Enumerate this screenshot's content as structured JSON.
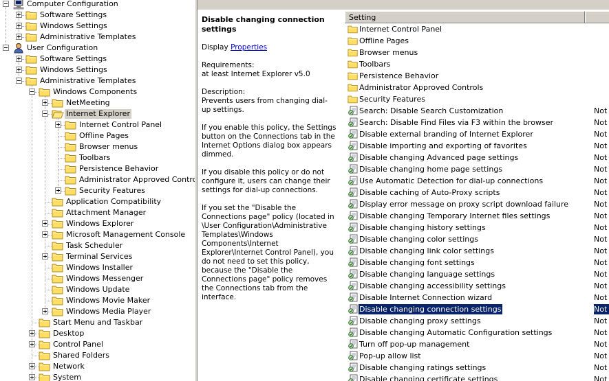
{
  "tree": [
    {
      "label": "Computer Configuration",
      "icon": "computer-icon",
      "toggle": "minus"
    },
    {
      "label": "Software Settings",
      "icon": "folder-icon",
      "toggle": "plus"
    },
    {
      "label": "Windows Settings",
      "icon": "folder-icon",
      "toggle": "plus"
    },
    {
      "label": "Administrative Templates",
      "icon": "folder-icon",
      "toggle": "plus"
    },
    {
      "label": "User Configuration",
      "icon": "user-icon",
      "toggle": "minus"
    },
    {
      "label": "Software Settings",
      "icon": "folder-icon",
      "toggle": "plus"
    },
    {
      "label": "Windows Settings",
      "icon": "folder-icon",
      "toggle": "plus"
    },
    {
      "label": "Administrative Templates",
      "icon": "folder-icon",
      "toggle": "minus"
    },
    {
      "label": "Windows Components",
      "icon": "folder-icon",
      "toggle": "minus"
    },
    {
      "label": "NetMeeting",
      "icon": "folder-icon",
      "toggle": "plus"
    },
    {
      "label": "Internet Explorer",
      "icon": "folder-open-icon",
      "toggle": "minus",
      "selected": true
    },
    {
      "label": "Internet Control Panel",
      "icon": "folder-icon",
      "toggle": "plus"
    },
    {
      "label": "Offline Pages",
      "icon": "folder-icon",
      "toggle": ""
    },
    {
      "label": "Browser menus",
      "icon": "folder-icon",
      "toggle": ""
    },
    {
      "label": "Toolbars",
      "icon": "folder-icon",
      "toggle": ""
    },
    {
      "label": "Persistence Behavior",
      "icon": "folder-icon",
      "toggle": ""
    },
    {
      "label": "Administrator Approved Controls",
      "icon": "folder-icon",
      "toggle": ""
    },
    {
      "label": "Security Features",
      "icon": "folder-icon",
      "toggle": "plus"
    },
    {
      "label": "Application Compatibility",
      "icon": "folder-icon",
      "toggle": ""
    },
    {
      "label": "Attachment Manager",
      "icon": "folder-icon",
      "toggle": ""
    },
    {
      "label": "Windows Explorer",
      "icon": "folder-icon",
      "toggle": "plus"
    },
    {
      "label": "Microsoft Management Console",
      "icon": "folder-icon",
      "toggle": "plus"
    },
    {
      "label": "Task Scheduler",
      "icon": "folder-icon",
      "toggle": ""
    },
    {
      "label": "Terminal Services",
      "icon": "folder-icon",
      "toggle": "plus"
    },
    {
      "label": "Windows Installer",
      "icon": "folder-icon",
      "toggle": ""
    },
    {
      "label": "Windows Messenger",
      "icon": "folder-icon",
      "toggle": ""
    },
    {
      "label": "Windows Update",
      "icon": "folder-icon",
      "toggle": ""
    },
    {
      "label": "Windows Movie Maker",
      "icon": "folder-icon",
      "toggle": ""
    },
    {
      "label": "Windows Media Player",
      "icon": "folder-icon",
      "toggle": "plus"
    },
    {
      "label": "Start Menu and Taskbar",
      "icon": "folder-icon",
      "toggle": ""
    },
    {
      "label": "Desktop",
      "icon": "folder-icon",
      "toggle": "plus"
    },
    {
      "label": "Control Panel",
      "icon": "folder-icon",
      "toggle": "plus"
    },
    {
      "label": "Shared Folders",
      "icon": "folder-icon",
      "toggle": ""
    },
    {
      "label": "Network",
      "icon": "folder-icon",
      "toggle": "plus"
    },
    {
      "label": "System",
      "icon": "folder-icon",
      "toggle": "plus"
    }
  ],
  "description": {
    "title": "Disable changing connection settings",
    "display_label": "Display",
    "display_link": "Properties",
    "requirements_label": "Requirements:",
    "requirements_value": "at least Internet Explorer v5.0",
    "description_label": "Description:",
    "description_value": "Prevents users from changing dial-up settings.",
    "para_enable": "If you enable this policy, the Settings button on the Connections tab in the Internet Options dialog box appears dimmed.",
    "para_disable": "If you disable this policy or do not configure it, users can change their settings for dial-up connections.",
    "para_note": "If you set the \"Disable the Connections page\" policy (located in \\User Configuration\\Administrative Templates\\Windows Components\\Internet Explorer\\Internet Control Panel), you do not need to set this policy, because the \"Disable the Connections page\" policy removes the Connections tab from the interface."
  },
  "list": {
    "header_setting": "Setting",
    "rows": [
      {
        "name": "Internet Control Panel",
        "type": "folder",
        "state": ""
      },
      {
        "name": "Offline Pages",
        "type": "folder",
        "state": ""
      },
      {
        "name": "Browser menus",
        "type": "folder",
        "state": ""
      },
      {
        "name": "Toolbars",
        "type": "folder",
        "state": ""
      },
      {
        "name": "Persistence Behavior",
        "type": "folder",
        "state": ""
      },
      {
        "name": "Administrator Approved Controls",
        "type": "folder",
        "state": ""
      },
      {
        "name": "Security Features",
        "type": "folder",
        "state": ""
      },
      {
        "name": "Search: Disable Search Customization",
        "type": "policy",
        "state": "Not"
      },
      {
        "name": "Search: Disable Find Files via F3 within the browser",
        "type": "policy",
        "state": "Not"
      },
      {
        "name": "Disable external branding of Internet Explorer",
        "type": "policy",
        "state": "Not"
      },
      {
        "name": "Disable importing and exporting of favorites",
        "type": "policy",
        "state": "Not"
      },
      {
        "name": "Disable changing Advanced page settings",
        "type": "policy",
        "state": "Not"
      },
      {
        "name": "Disable changing home page settings",
        "type": "policy",
        "state": "Not"
      },
      {
        "name": "Use Automatic Detection for dial-up connections",
        "type": "policy",
        "state": "Not"
      },
      {
        "name": "Disable caching of Auto-Proxy scripts",
        "type": "policy",
        "state": "Not"
      },
      {
        "name": "Display error message on proxy script download failure",
        "type": "policy",
        "state": "Not"
      },
      {
        "name": "Disable changing Temporary Internet files settings",
        "type": "policy",
        "state": "Not"
      },
      {
        "name": "Disable changing history settings",
        "type": "policy",
        "state": "Not"
      },
      {
        "name": "Disable changing color settings",
        "type": "policy",
        "state": "Not"
      },
      {
        "name": "Disable changing link color settings",
        "type": "policy",
        "state": "Not"
      },
      {
        "name": "Disable changing font settings",
        "type": "policy",
        "state": "Not"
      },
      {
        "name": "Disable changing language settings",
        "type": "policy",
        "state": "Not"
      },
      {
        "name": "Disable changing accessibility settings",
        "type": "policy",
        "state": "Not"
      },
      {
        "name": "Disable Internet Connection wizard",
        "type": "policy",
        "state": "Not"
      },
      {
        "name": "Disable changing connection settings",
        "type": "policy",
        "state": "Not",
        "selected": true
      },
      {
        "name": "Disable changing proxy settings",
        "type": "policy",
        "state": "Not"
      },
      {
        "name": "Disable changing Automatic Configuration settings",
        "type": "policy",
        "state": "Not"
      },
      {
        "name": "Turn off pop-up management",
        "type": "policy",
        "state": "Not"
      },
      {
        "name": "Pop-up allow list",
        "type": "policy",
        "state": "Not"
      },
      {
        "name": "Disable changing ratings settings",
        "type": "policy",
        "state": "Not"
      },
      {
        "name": "Disable changing certificate settings",
        "type": "policy",
        "state": "Not"
      }
    ]
  },
  "colors": {
    "folder_fill": "#ffde63",
    "folder_edge": "#b08c2c",
    "selection": "#0a246a",
    "chrome": "#d4d0c8",
    "link": "#0000cc"
  }
}
